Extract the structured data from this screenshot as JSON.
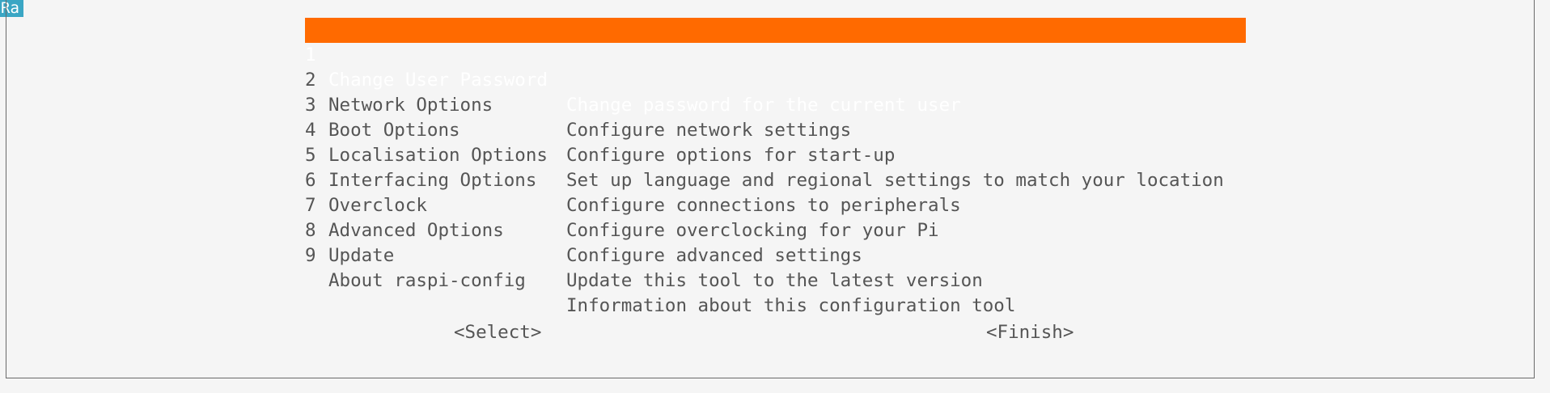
{
  "corner_tag": "Ra",
  "menu": {
    "selected_index": 0,
    "items": [
      {
        "number": "1",
        "name": "Change User Password",
        "description": "Change password for the current user"
      },
      {
        "number": "2",
        "name": "Network Options",
        "description": "Configure network settings"
      },
      {
        "number": "3",
        "name": "Boot Options",
        "description": "Configure options for start-up"
      },
      {
        "number": "4",
        "name": "Localisation Options",
        "description": "Set up language and regional settings to match your location"
      },
      {
        "number": "5",
        "name": "Interfacing Options",
        "description": "Configure connections to peripherals"
      },
      {
        "number": "6",
        "name": "Overclock",
        "description": "Configure overclocking for your Pi"
      },
      {
        "number": "7",
        "name": "Advanced Options",
        "description": "Configure advanced settings"
      },
      {
        "number": "8",
        "name": "Update",
        "description": "Update this tool to the latest version"
      },
      {
        "number": "9",
        "name": "About raspi-config",
        "description": "Information about this configuration tool"
      }
    ]
  },
  "buttons": {
    "select_label": "<Select>",
    "finish_label": "<Finish>"
  },
  "colors": {
    "background": "#f5f5f5",
    "highlight": "#ff6a00",
    "text": "#555555",
    "corner_tag": "#3aa6c4"
  }
}
